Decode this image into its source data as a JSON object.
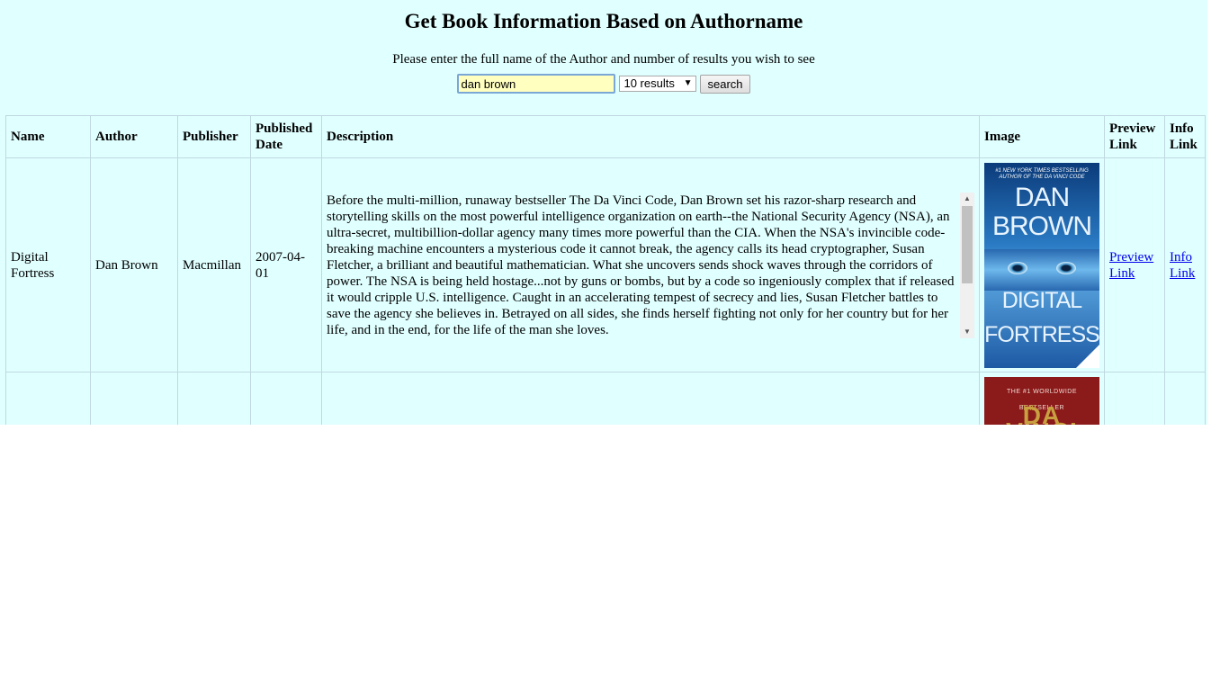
{
  "header": {
    "title": "Get Book Information Based on Authorname",
    "instructions": "Please enter the full name of the Author and number of results you wish to see"
  },
  "search": {
    "value": "dan brown",
    "results_selected": "10 results",
    "button_label": "search"
  },
  "table": {
    "headers": {
      "name": "Name",
      "author": "Author",
      "publisher": "Publisher",
      "published_date": "Published Date",
      "description": "Description",
      "image": "Image",
      "preview_link": "Preview Link",
      "info_link": "Info Link"
    },
    "rows": [
      {
        "name": "Digital Fortress",
        "author": "Dan Brown",
        "publisher": "Macmillan",
        "published_date": "2007-04-01",
        "description": "Before the multi-million, runaway bestseller The Da Vinci Code, Dan Brown set his razor-sharp research and storytelling skills on the most powerful intelligence organization on earth--the National Security Agency (NSA), an ultra-secret, multibillion-dollar agency many times more powerful than the CIA. When the NSA's invincible code-breaking machine encounters a mysterious code it cannot break, the agency calls its head cryptographer, Susan Fletcher, a brilliant and beautiful mathematician. What she uncovers sends shock waves through the corridors of power. The NSA is being held hostage...not by guns or bombs, but by a code so ingeniously complex that if released it would cripple U.S. intelligence. Caught in an accelerating tempest of secrecy and lies, Susan Fletcher battles to save the agency she believes in. Betrayed on all sides, she finds herself fighting not only for her country but for her life, and in the end, for the life of the man she loves.",
        "cover": {
          "blurb": "#1 NEW YORK TIMES BESTSELLING AUTHOR OF THE DA VINCI CODE",
          "author_line1": "DAN",
          "author_line2": "BROWN",
          "title_line1": "DIGITAL",
          "title_line2": "FORTRESS"
        },
        "preview_link": "Preview Link",
        "info_link": "Info Link"
      },
      {
        "cover": {
          "blurb": "THE #1 WORLDWIDE BESTSELLER",
          "the": "THE",
          "title_partial": "DA VINCI"
        }
      }
    ]
  }
}
